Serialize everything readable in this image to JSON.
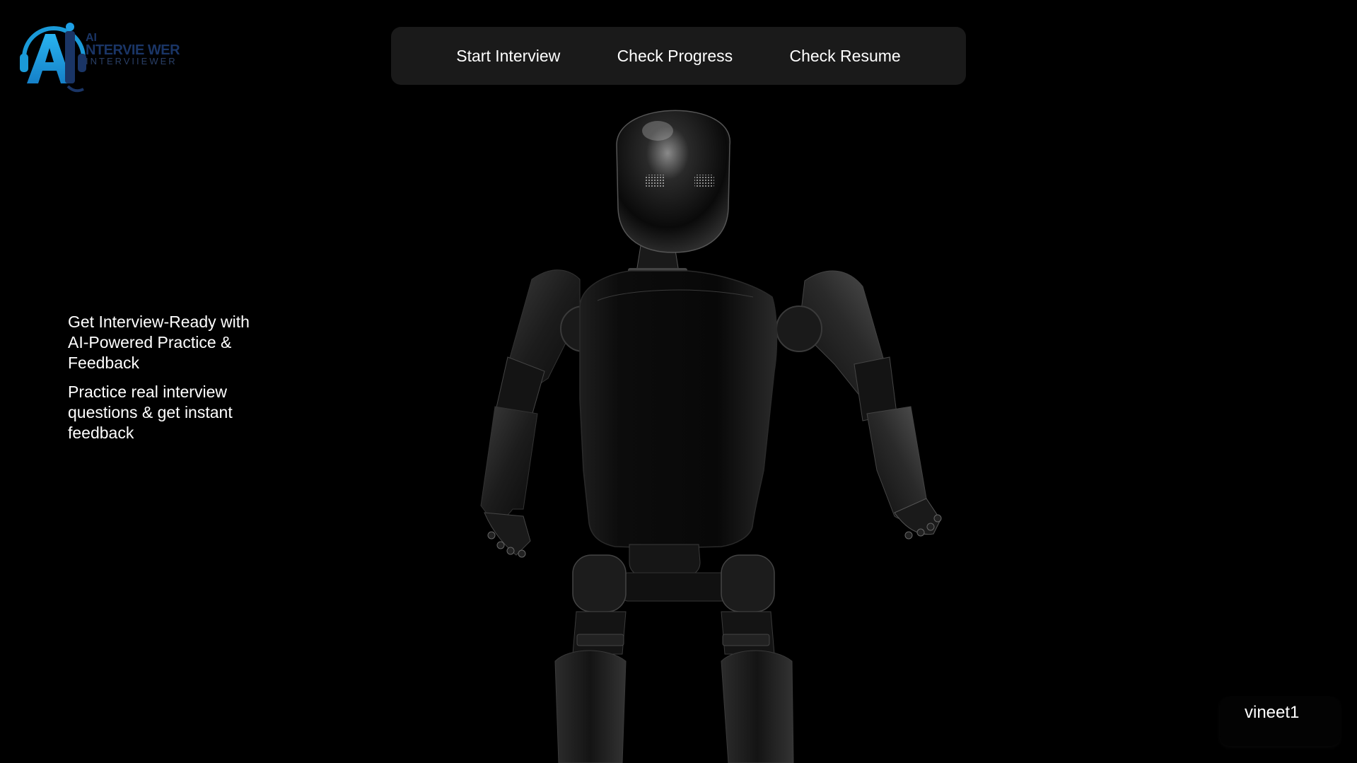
{
  "logo": {
    "line1": "AI",
    "line2": "NTERVIE WER",
    "line3": "INTERVIIEWER",
    "mark_letter": "AI",
    "colors": {
      "mark_primary": "#1ea0e6",
      "mark_dark": "#1a3566",
      "text": "#1a3566"
    }
  },
  "nav": {
    "items": [
      {
        "label": "Start Interview"
      },
      {
        "label": "Check Progress"
      },
      {
        "label": "Check Resume"
      }
    ]
  },
  "hero": {
    "title": "Get Interview-Ready with AI-Powered Practice & Feedback",
    "subtitle": "Practice real interview questions & get instant feedback"
  },
  "user": {
    "name": "vineet1"
  },
  "colors": {
    "background": "#000000",
    "nav_background": "#1a1a1a",
    "text": "#ffffff"
  }
}
